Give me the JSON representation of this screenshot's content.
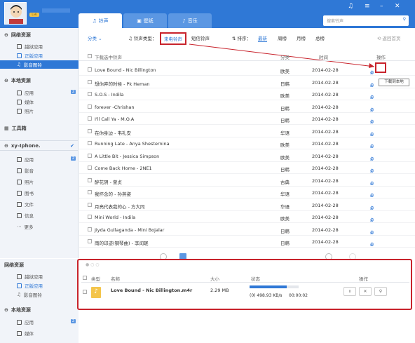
{
  "header": {
    "tabs": [
      {
        "label": "铃声"
      },
      {
        "label": "壁纸"
      },
      {
        "label": "音乐"
      }
    ],
    "search_placeholder": "搜索铃声",
    "badge": "Lv6"
  },
  "sidebar": {
    "sections": [
      {
        "label": "网络资源"
      },
      {
        "label": "本地资源"
      },
      {
        "label": "工具箱"
      },
      {
        "label": "xy-Iphone."
      }
    ],
    "net_items": [
      {
        "label": "越狱应用"
      },
      {
        "label": "正版应用"
      },
      {
        "label": "影音图铃"
      }
    ],
    "local_items": [
      {
        "label": "应用",
        "count": "2"
      },
      {
        "label": "媒体"
      },
      {
        "label": "照片"
      }
    ],
    "device_items": [
      {
        "label": "应用",
        "count": "2"
      },
      {
        "label": "影音"
      },
      {
        "label": "照片"
      },
      {
        "label": "图书"
      },
      {
        "label": "文件"
      },
      {
        "label": "信息"
      },
      {
        "label": "更多"
      }
    ]
  },
  "toolbar": {
    "category": "分类",
    "type_label": "铃声类型：",
    "type_selected": "来电铃声",
    "type_other": "短信铃声",
    "sort_label": "排序：",
    "sort_options": [
      "最新",
      "周榜",
      "月榜",
      "总榜"
    ],
    "back_label": "返回首页"
  },
  "table": {
    "select_all": "下载选中铃声",
    "col_category": "分类",
    "col_time": "时间",
    "col_ops": "操作",
    "rows": [
      {
        "title": "Love Bound - Nic Billington",
        "category": "欧美",
        "time": "2014-02-28"
      },
      {
        "title": "想你弃的时候 - Pk Heman",
        "category": "日韩",
        "time": "2014-02-28"
      },
      {
        "title": "S.O.S - Indila",
        "category": "欧美",
        "time": "2014-02-28"
      },
      {
        "title": "forever -Chrishan",
        "category": "日韩",
        "time": "2014-02-28"
      },
      {
        "title": "I'll Call Ya - M.O.A",
        "category": "日韩",
        "time": "2014-02-28"
      },
      {
        "title": "在你身边 - 韦礼安",
        "category": "华语",
        "time": "2014-02-28"
      },
      {
        "title": "Running Late - Anya Shesternina",
        "category": "欧美",
        "time": "2014-02-28"
      },
      {
        "title": "A Little Bit - Jessica Simpson",
        "category": "欧美",
        "time": "2014-02-28"
      },
      {
        "title": "Come Back Home - 2NE1",
        "category": "日韩",
        "time": "2014-02-28"
      },
      {
        "title": "醉花阴 - 萱贞",
        "category": "古典",
        "time": "2014-02-28"
      },
      {
        "title": "我怀念的 - 孙燕姿",
        "category": "华语",
        "time": "2014-02-28"
      },
      {
        "title": "月亮代表我的心 - 方大同",
        "category": "华语",
        "time": "2014-02-28"
      },
      {
        "title": "Mini World - Indila",
        "category": "欧美",
        "time": "2014-02-28"
      },
      {
        "title": "Jiyda Gullaganda - Mini Bojalar",
        "category": "日韩",
        "time": "2014-02-28"
      },
      {
        "title": "雨的印迹(钢琴曲) - 李闰珉",
        "category": "日韩",
        "time": "2014-02-28"
      }
    ]
  },
  "tooltip": "下载到本地",
  "bottom_sidebar": {
    "items": [
      {
        "label": "网络资源"
      },
      {
        "label": "越狱应用"
      },
      {
        "label": "正版应用"
      },
      {
        "label": "影音图铃"
      },
      {
        "label": "本地资源"
      },
      {
        "label": "应用",
        "count": "2"
      },
      {
        "label": "媒体"
      }
    ]
  },
  "downloads": {
    "col_type": "类型",
    "col_name": "名称",
    "col_size": "大小",
    "col_status": "状态",
    "col_ops": "操作",
    "item": {
      "name": "Love Bound - Nic Billington.m4r",
      "size": "2.29 MB",
      "status": "(0)  498.93 KB/s",
      "time": "00:00:02",
      "progress": 0.75
    }
  },
  "colors": {
    "accent": "#2f78d6",
    "annotation": "#c8232c"
  }
}
